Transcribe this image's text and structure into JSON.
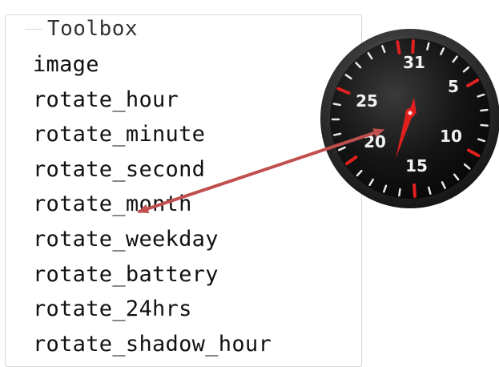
{
  "toolbox": {
    "title": "Toolbox",
    "items": [
      "image",
      "rotate_hour",
      "rotate_minute",
      "rotate_second",
      "rotate_month",
      "rotate_weekday",
      "rotate_battery",
      "rotate_24hrs",
      "rotate_shadow_hour"
    ]
  },
  "dial": {
    "numbers": [
      "31",
      "5",
      "10",
      "15",
      "20",
      "25"
    ],
    "accent_color": "#e02020",
    "arrow_color": "#c0504d"
  }
}
